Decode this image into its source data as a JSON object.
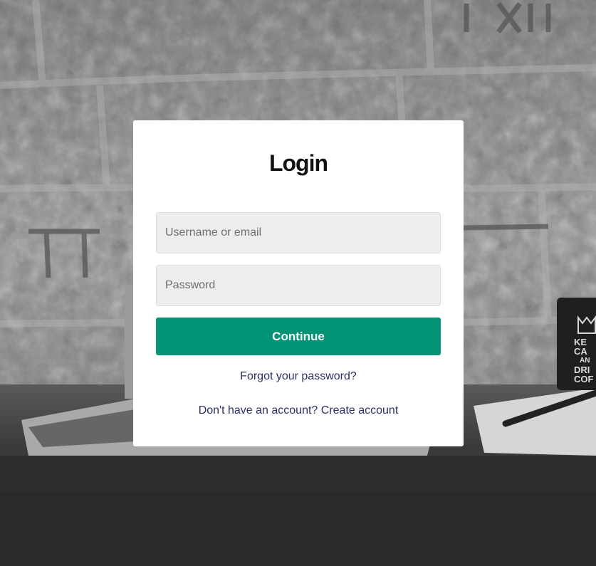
{
  "login": {
    "title": "Login",
    "username_placeholder": "Username or email",
    "password_placeholder": "Password",
    "continue_label": "Continue",
    "forgot_label": "Forgot your password?",
    "signup_label": "Don't have an account? Create account"
  },
  "colors": {
    "primary_button": "#029475",
    "link": "#2b2f63",
    "input_bg": "#ededed"
  },
  "background": {
    "mug_text": [
      "KE",
      "CA",
      "AN",
      "DRI",
      "COF"
    ]
  }
}
